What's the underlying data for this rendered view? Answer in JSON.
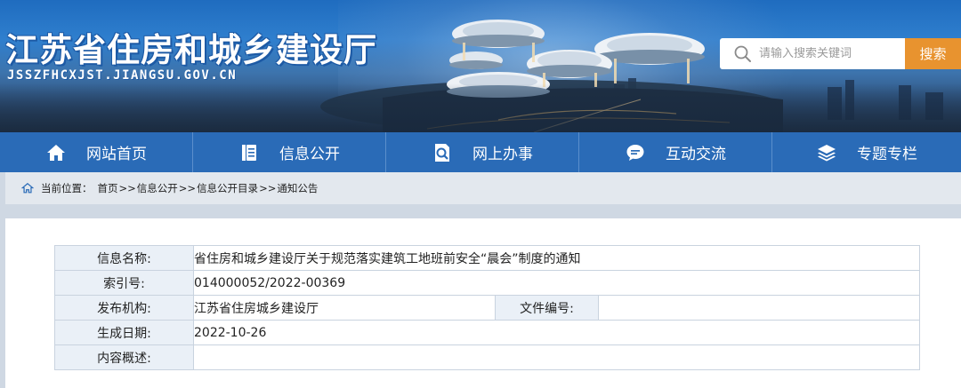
{
  "header": {
    "site_title": "江苏省住房和城乡建设厅",
    "site_domain": "JSSZFHCXJST.JIANGSU.GOV.CN",
    "search_placeholder": "请输入搜索关键词",
    "search_button": "搜索"
  },
  "nav": {
    "items": [
      {
        "label": "网站首页",
        "icon": "home-icon"
      },
      {
        "label": "信息公开",
        "icon": "document-icon"
      },
      {
        "label": "网上办事",
        "icon": "service-search-icon"
      },
      {
        "label": "互动交流",
        "icon": "chat-bubble-icon"
      },
      {
        "label": "专题专栏",
        "icon": "layers-icon"
      }
    ]
  },
  "breadcrumb": {
    "label": "当前位置：",
    "items": [
      "首页",
      "信息公开",
      "信息公开目录",
      "通知公告"
    ],
    "separator": ">>"
  },
  "document_info": {
    "name_label": "信息名称:",
    "name_value": "省住房和城乡建设厅关于规范落实建筑工地班前安全“晨会”制度的通知",
    "index_label": "索引号:",
    "index_value": "014000052/2022-00369",
    "publisher_label": "发布机构:",
    "publisher_value": "江苏省住房城乡建设厅",
    "file_no_label": "文件编号:",
    "file_no_value": "",
    "date_label": "生成日期:",
    "date_value": "2022-10-26",
    "summary_label": "内容概述:",
    "summary_value": ""
  },
  "colors": {
    "nav_bg": "#2a6bb7",
    "search_button": "#e8932f",
    "label_cell_bg": "#eaf0f7"
  }
}
